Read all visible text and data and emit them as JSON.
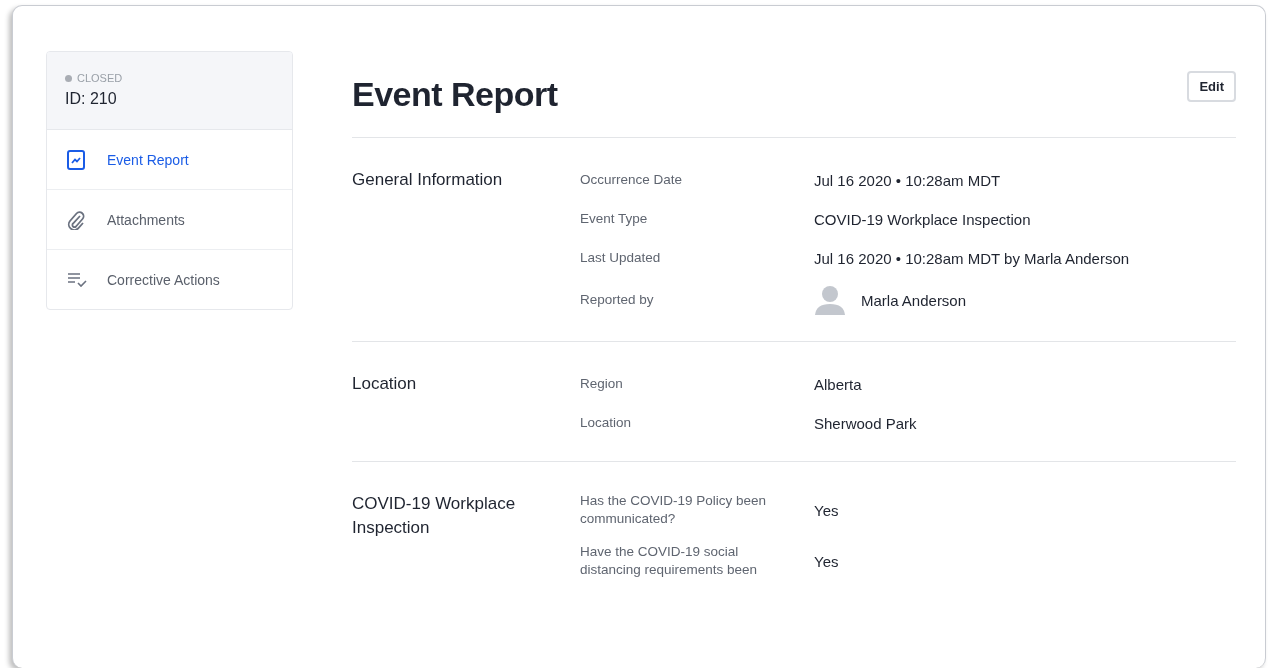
{
  "sidebar": {
    "status": "CLOSED",
    "id": "ID: 210",
    "items": [
      {
        "label": "Event Report",
        "kind": "report",
        "selected": true
      },
      {
        "label": "Attachments",
        "kind": "attachments",
        "selected": false
      },
      {
        "label": "Corrective Actions",
        "kind": "actions",
        "selected": false
      }
    ]
  },
  "page": {
    "title": "Event Report",
    "edit_button": "Edit"
  },
  "sections": [
    {
      "title": "General Information",
      "rows": [
        {
          "kind": "text",
          "label": "Occurrence Date",
          "value": "Jul 16 2020 • 10:28am MDT"
        },
        {
          "kind": "text",
          "label": "Event Type",
          "value": "COVID-19 Workplace Inspection"
        },
        {
          "kind": "text",
          "label": "Last Updated",
          "value": "Jul 16 2020 • 10:28am MDT by Marla Anderson"
        },
        {
          "kind": "person",
          "label": "Reported by",
          "value": "Marla Anderson"
        }
      ]
    },
    {
      "title": "Location",
      "rows": [
        {
          "kind": "text",
          "label": "Region",
          "value": "Alberta"
        },
        {
          "kind": "text",
          "label": "Location",
          "value": "Sherwood Park"
        }
      ]
    },
    {
      "title": "COVID-19 Workplace Inspection",
      "rows": [
        {
          "kind": "text",
          "label": "Has the COVID-19 Policy been communicated?",
          "value": "Yes"
        },
        {
          "kind": "text",
          "label": "Have the COVID-19 social distancing requirements been",
          "value": "Yes"
        }
      ]
    }
  ]
}
